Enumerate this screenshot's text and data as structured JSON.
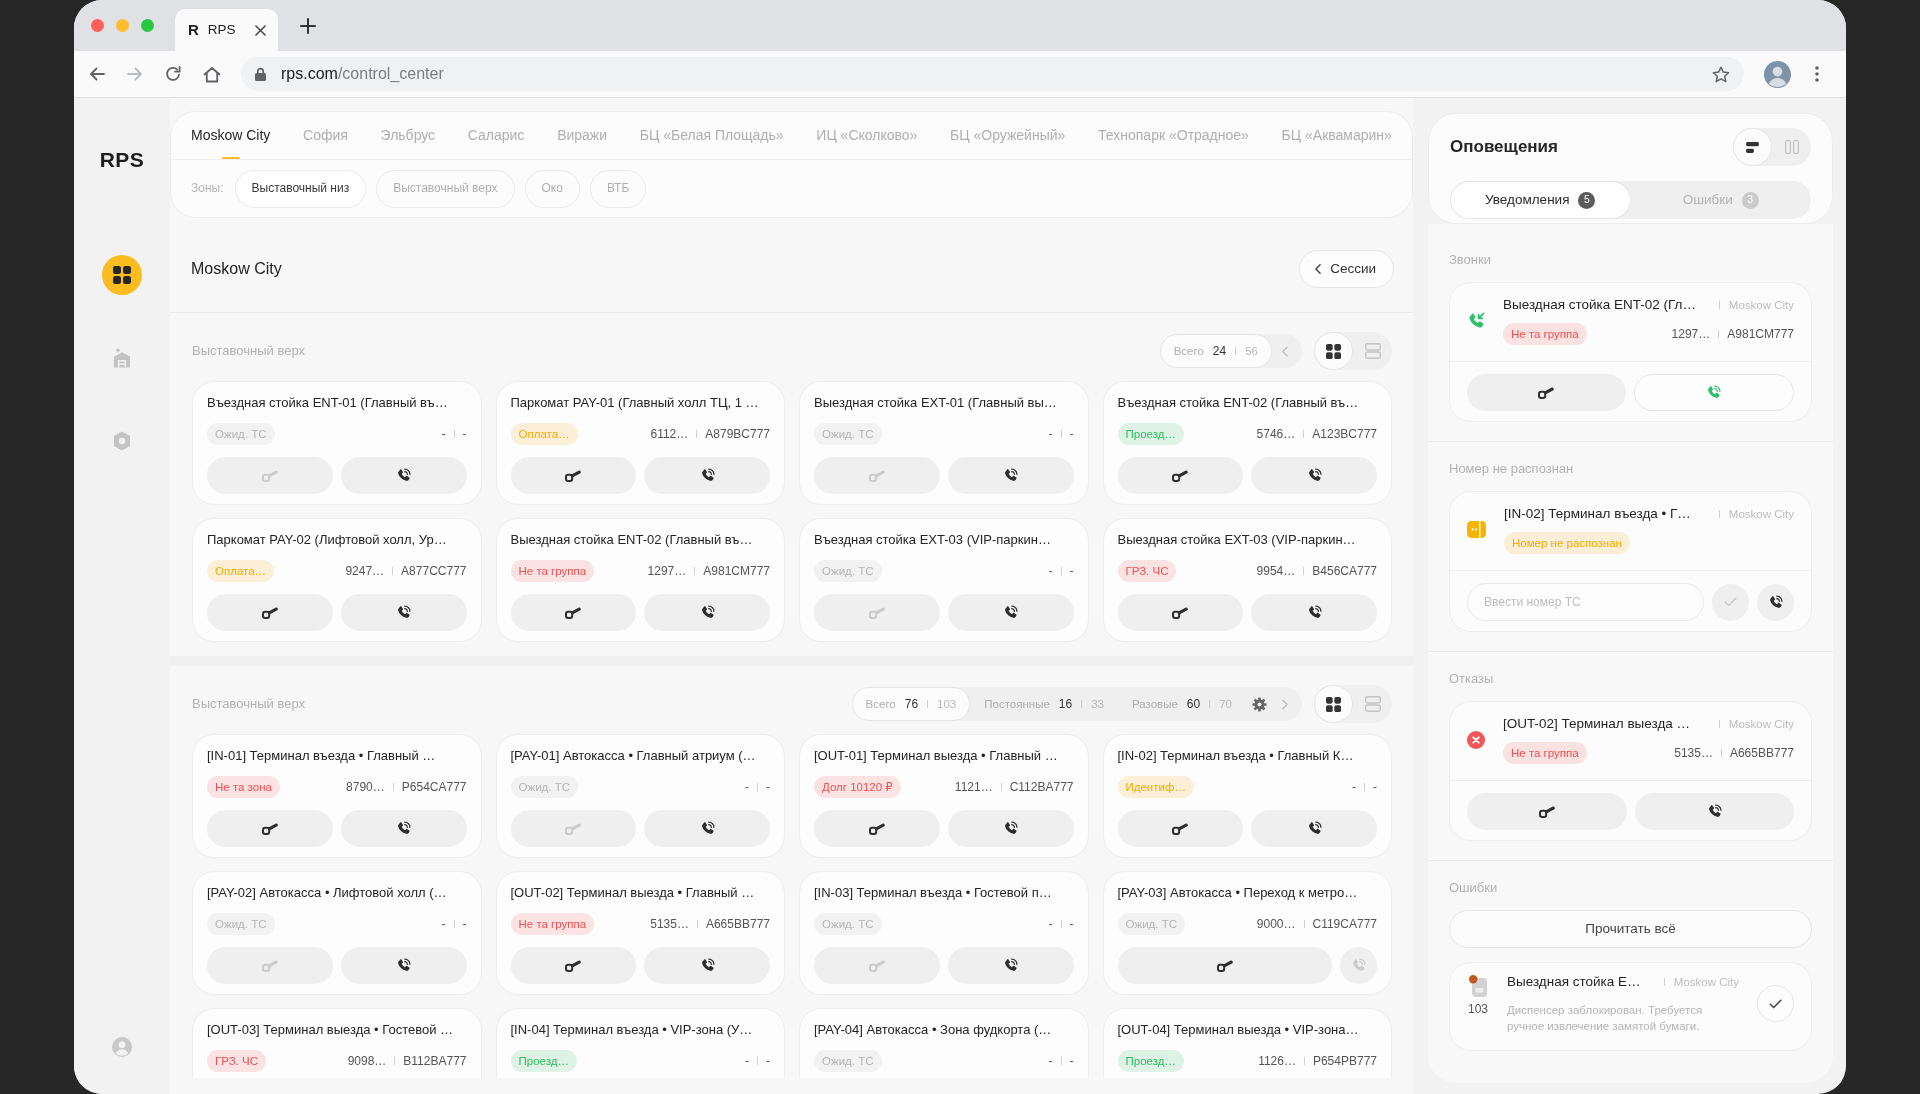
{
  "browser": {
    "favicon": "R",
    "tab_title": "RPS",
    "forward_enabled": false,
    "url_host": "rps.com",
    "url_path": "/control_center"
  },
  "sidebar": {
    "logo": "RPS",
    "items": [
      {
        "kind": "dashboard",
        "selected": true
      },
      {
        "kind": "objects",
        "selected": false
      },
      {
        "kind": "equipment",
        "selected": false
      }
    ]
  },
  "location_tabs": [
    {
      "label": "Moskow City",
      "selected": true
    },
    {
      "label": "София",
      "selected": false
    },
    {
      "label": "Эльбрус",
      "selected": false
    },
    {
      "label": "Саларис",
      "selected": false
    },
    {
      "label": "Виражи",
      "selected": false
    },
    {
      "label": "БЦ «Белая Площадь»",
      "selected": false
    },
    {
      "label": "ИЦ «Сколково»",
      "selected": false
    },
    {
      "label": "БЦ «Оружейный»",
      "selected": false
    },
    {
      "label": "Технопарк «Отрадное»",
      "selected": false
    },
    {
      "label": "БЦ «Аквамарин»",
      "selected": false
    }
  ],
  "zones": {
    "label": "Зоны:",
    "items": [
      {
        "label": "Выставочный низ",
        "selected": true
      },
      {
        "label": "Выставочный верх",
        "selected": false
      },
      {
        "label": "Око",
        "selected": false
      },
      {
        "label": "ВТБ",
        "selected": false
      }
    ]
  },
  "header": {
    "title": "Moskow City",
    "sessions_button": "Сессии"
  },
  "sections": [
    {
      "title": "Выставочный верх",
      "counters": [
        {
          "label": "Всего",
          "value": "24",
          "total": "56",
          "selected": true
        }
      ],
      "controls": [
        {
          "kind": "previous"
        }
      ],
      "view_modes": [
        {
          "kind": "grid",
          "selected": true
        },
        {
          "kind": "list",
          "selected": false
        }
      ],
      "cards": [
        {
          "title": "Въездная стойка ENT-01 (Главный въ…",
          "status": {
            "label": "Ожид. ТС",
            "color": "#b5b5b5"
          },
          "ticket": "-",
          "plate": "-",
          "actions": [
            {
              "kind": "barrier",
              "disabled": true
            },
            {
              "kind": "call",
              "disabled": false
            }
          ]
        },
        {
          "title": "Паркомат PAY-01 (Главный холл ТЦ, 1 …",
          "status": {
            "label": "Оплата…",
            "color": "#f2a900"
          },
          "ticket": "6112…",
          "plate": "A879BC777",
          "actions": [
            {
              "kind": "barrier",
              "disabled": false
            },
            {
              "kind": "call",
              "disabled": false
            }
          ]
        },
        {
          "title": "Выездная стойка EXT-01 (Главный вы…",
          "status": {
            "label": "Ожид. ТС",
            "color": "#b5b5b5"
          },
          "ticket": "-",
          "plate": "-",
          "actions": [
            {
              "kind": "barrier",
              "disabled": true
            },
            {
              "kind": "call",
              "disabled": false
            }
          ]
        },
        {
          "title": "Въездная стойка ENT-02 (Главный въ…",
          "status": {
            "label": "Проезд…",
            "color": "#2dbd5f"
          },
          "ticket": "5746…",
          "plate": "A123BC777",
          "actions": [
            {
              "kind": "barrier",
              "disabled": false
            },
            {
              "kind": "call",
              "disabled": false
            }
          ]
        },
        {
          "title": "Паркомат PAY-02 (Лифтовой холл, Ур…",
          "status": {
            "label": "Оплата…",
            "color": "#f2a900"
          },
          "ticket": "9247…",
          "plate": "A877CC777",
          "actions": [
            {
              "kind": "barrier",
              "disabled": false
            },
            {
              "kind": "call",
              "disabled": false
            }
          ]
        },
        {
          "title": "Выездная стойка ENT-02 (Главный въ…",
          "status": {
            "label": "Не та группа",
            "color": "#f04f4f"
          },
          "ticket": "1297…",
          "plate": "A981CM777",
          "actions": [
            {
              "kind": "barrier",
              "disabled": false
            },
            {
              "kind": "call",
              "disabled": false
            }
          ]
        },
        {
          "title": "Въездная стойка EXT-03 (VIP-паркин…",
          "status": {
            "label": "Ожид. ТС",
            "color": "#b5b5b5"
          },
          "ticket": "-",
          "plate": "-",
          "actions": [
            {
              "kind": "barrier",
              "disabled": true
            },
            {
              "kind": "call",
              "disabled": false
            }
          ]
        },
        {
          "title": "Выездная стойка EXT-03 (VIP-паркин…",
          "status": {
            "label": "ГРЗ. ЧС",
            "color": "#f04f4f"
          },
          "ticket": "9954…",
          "plate": "B456CA777",
          "actions": [
            {
              "kind": "barrier",
              "disabled": false
            },
            {
              "kind": "call",
              "disabled": false
            }
          ]
        }
      ]
    },
    {
      "title": "Выставочный верх",
      "counters": [
        {
          "label": "Всего",
          "value": "76",
          "total": "103",
          "selected": true
        },
        {
          "label": "Постоянные",
          "value": "16",
          "total": "33",
          "selected": false
        },
        {
          "label": "Разовые",
          "value": "60",
          "total": "70",
          "selected": false
        }
      ],
      "controls": [
        {
          "kind": "settings"
        },
        {
          "kind": "next"
        }
      ],
      "view_modes": [
        {
          "kind": "grid",
          "selected": true
        },
        {
          "kind": "list",
          "selected": false
        }
      ],
      "cards": [
        {
          "title": "[IN-01] Терминал въезда • Главный …",
          "status": {
            "label": "Не та зона",
            "color": "#f04f4f"
          },
          "ticket": "8790…",
          "plate": "P654CA777",
          "actions": [
            {
              "kind": "barrier",
              "disabled": false
            },
            {
              "kind": "call",
              "disabled": false
            }
          ]
        },
        {
          "title": "[PAY-01] Автокасса • Главный атриум (…",
          "status": {
            "label": "Ожид. ТС",
            "color": "#b5b5b5"
          },
          "ticket": "-",
          "plate": "-",
          "actions": [
            {
              "kind": "barrier",
              "disabled": true
            },
            {
              "kind": "call",
              "disabled": false
            }
          ]
        },
        {
          "title": "[OUT-01] Терминал выезда • Главный …",
          "status": {
            "label": "Долг 10120 ₽",
            "color": "#f04f4f"
          },
          "ticket": "1121…",
          "plate": "C112BA777",
          "actions": [
            {
              "kind": "barrier",
              "disabled": false
            },
            {
              "kind": "call",
              "disabled": false
            }
          ]
        },
        {
          "title": "[IN-02] Терминал въезда • Главный К…",
          "status": {
            "label": "Идентиф…",
            "color": "#f2a900"
          },
          "ticket": "-",
          "plate": "-",
          "actions": [
            {
              "kind": "barrier",
              "disabled": false
            },
            {
              "kind": "call",
              "disabled": false
            }
          ]
        },
        {
          "title": "[PAY-02] Автокасса • Лифтовой холл (…",
          "status": {
            "label": "Ожид. ТС",
            "color": "#b5b5b5"
          },
          "ticket": "-",
          "plate": "-",
          "actions": [
            {
              "kind": "barrier",
              "disabled": true
            },
            {
              "kind": "call",
              "disabled": false
            }
          ]
        },
        {
          "title": "[OUT-02] Терминал выезда • Главный …",
          "status": {
            "label": "Не та группа",
            "color": "#f04f4f"
          },
          "ticket": "5135…",
          "plate": "A665BB777",
          "actions": [
            {
              "kind": "barrier",
              "disabled": false
            },
            {
              "kind": "call",
              "disabled": false
            }
          ]
        },
        {
          "title": "[IN-03] Терминал въезда • Гостевой п…",
          "status": {
            "label": "Ожид. ТС",
            "color": "#b5b5b5"
          },
          "ticket": "-",
          "plate": "-",
          "actions": [
            {
              "kind": "barrier",
              "disabled": true
            },
            {
              "kind": "call",
              "disabled": false
            }
          ]
        },
        {
          "title": "[PAY-03] Автокасса • Переход к метро…",
          "status": {
            "label": "Ожид. ТС",
            "color": "#b5b5b5"
          },
          "ticket": "9000…",
          "plate": "C119CA777",
          "actions": [
            {
              "kind": "barrier",
              "disabled": false
            },
            {
              "kind": "call-compact",
              "disabled": true
            }
          ]
        },
        {
          "title": "[OUT-03] Терминал выезда • Гостевой …",
          "status": {
            "label": "ГРЗ. ЧС",
            "color": "#f04f4f"
          },
          "ticket": "9098…",
          "plate": "B112BA777"
        },
        {
          "title": "[IN-04] Терминал въезда • VIP-зона (У…",
          "status": {
            "label": "Проезд…",
            "color": "#2dbd5f"
          },
          "ticket": "-",
          "plate": "-"
        },
        {
          "title": "[PAY-04] Автокасса • Зона фудкорта (…",
          "status": {
            "label": "Ожид. ТС",
            "color": "#b5b5b5"
          },
          "ticket": "-",
          "plate": "-"
        },
        {
          "title": "[OUT-04] Терминал выезда • VIP-зона…",
          "status": {
            "label": "Проезд…",
            "color": "#2dbd5f"
          },
          "ticket": "1126…",
          "plate": "P654PB777"
        }
      ]
    }
  ],
  "notifications": {
    "title": "Оповещения",
    "view_modes": [
      {
        "kind": "stacked",
        "selected": true
      },
      {
        "kind": "columns",
        "selected": false
      }
    ],
    "tabs": [
      {
        "label": "Уведомления",
        "count": "5",
        "selected": true
      },
      {
        "label": "Ошибки",
        "count": "3",
        "selected": false
      }
    ],
    "groups": [
      {
        "title": "Звонки",
        "items": [
          {
            "kind": "call",
            "title": "Выездная стойка ENT-02 (Гл…",
            "location": "Moskow City",
            "status": {
              "label": "Не та группа",
              "color": "#f04f4f"
            },
            "ticket": "1297…",
            "plate": "A981CM777",
            "actions": [
              {
                "kind": "barrier",
                "disabled": false
              },
              {
                "kind": "answer",
                "disabled": false
              }
            ]
          }
        ]
      },
      {
        "title": "Номер не распознан",
        "items": [
          {
            "kind": "unrecognized",
            "title": "[IN-02] Терминал въезда • Г…",
            "location": "Moskow City",
            "status": {
              "label": "Номер не распознан",
              "color": "#f2a900"
            },
            "plate_input": {
              "placeholder": "Ввести номер ТС"
            },
            "actions": [
              {
                "kind": "confirm",
                "disabled": true
              },
              {
                "kind": "call-compact",
                "disabled": false
              }
            ]
          }
        ]
      },
      {
        "title": "Отказы",
        "items": [
          {
            "kind": "refusal",
            "title": "[OUT-02] Терминал выезда …",
            "location": "Moskow City",
            "status": {
              "label": "Не та группа",
              "color": "#f04f4f"
            },
            "ticket": "5135…",
            "plate": "A665BB777",
            "actions": [
              {
                "kind": "barrier",
                "disabled": false
              },
              {
                "kind": "call",
                "disabled": false
              }
            ]
          }
        ]
      },
      {
        "title": "Ошибки",
        "read_all_button": "Прочитать всё",
        "items": [
          {
            "kind": "error",
            "title": "Выездная стойка Е…",
            "location": "Moskow City",
            "code": "103",
            "message": "Диспенсер заблокирован. Требуется ручное извлечение замятой бумаги.",
            "actions": [
              {
                "kind": "confirm",
                "disabled": false
              }
            ]
          }
        ]
      }
    ]
  }
}
